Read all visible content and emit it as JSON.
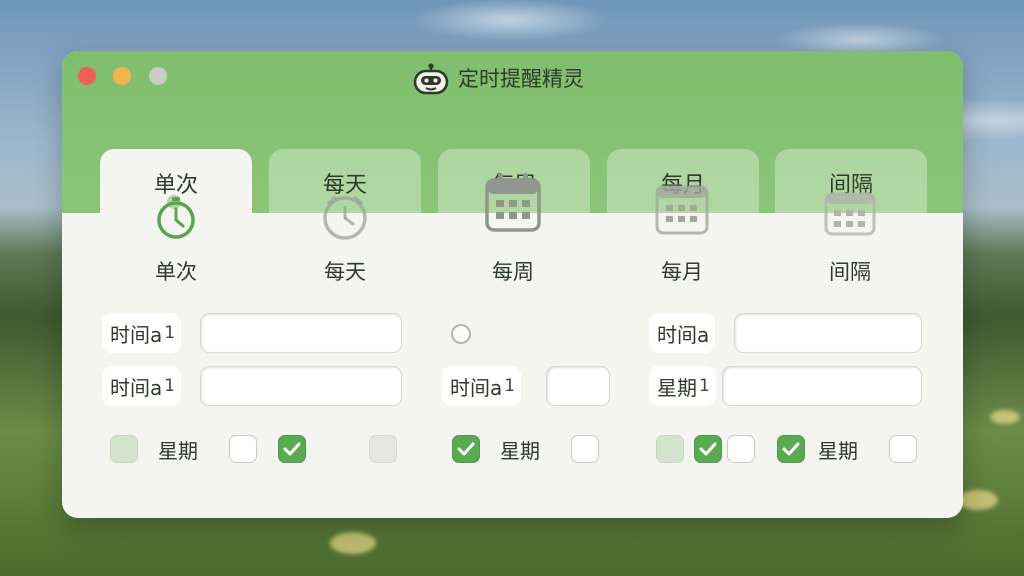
{
  "app": {
    "title": "定时提醒精灵",
    "accent": "#7fbe6c",
    "check_color": "#5aaa52",
    "logo_icon": "robot-icon"
  },
  "tabs": [
    {
      "label": "单次",
      "active": true
    },
    {
      "label": "每天",
      "active": false
    },
    {
      "label": "每周",
      "active": false
    },
    {
      "label": "每月",
      "active": false
    },
    {
      "label": "间隔",
      "active": false
    }
  ],
  "modes": [
    {
      "label": "单次",
      "icon": "stopwatch-icon"
    },
    {
      "label": "每天",
      "icon": "alarm-clock-icon"
    },
    {
      "label": "每周",
      "icon": "calendar-icon"
    },
    {
      "label": "每月",
      "icon": "calendar-month-icon"
    },
    {
      "label": "间隔",
      "icon": "calendar-grid-icon"
    }
  ],
  "form": {
    "left": {
      "row1_label": "时间a",
      "row1_num": "1",
      "row1_value": "",
      "row2_label": "时间a",
      "row2_num": "1",
      "row2_value": ""
    },
    "middle": {
      "row2_label": "时间a",
      "row2_num": "1",
      "row2_value": ""
    },
    "right": {
      "row1_label": "时间a",
      "row1_value": "",
      "row2_label": "星期",
      "row2_num": "1",
      "row2_value": ""
    },
    "weekday_label": "星期"
  }
}
